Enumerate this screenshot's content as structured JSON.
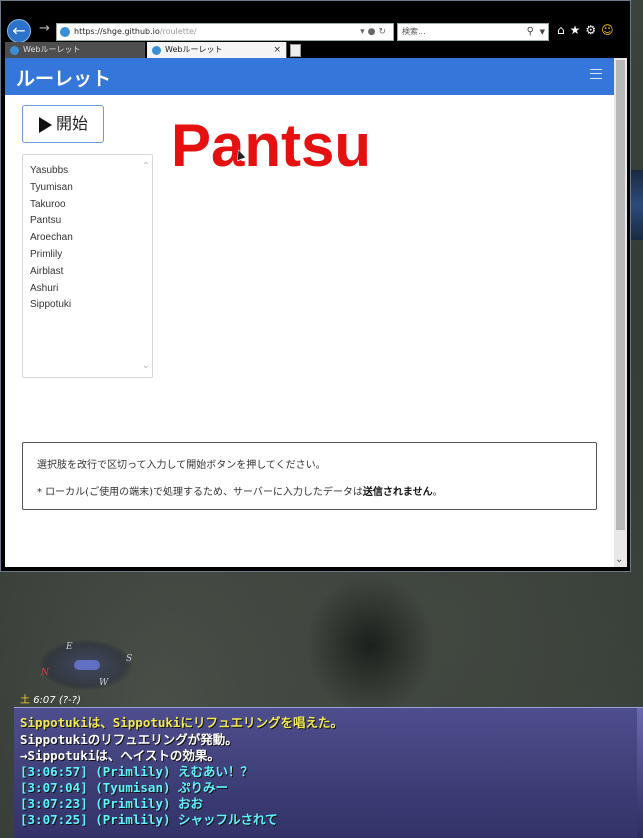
{
  "browser": {
    "url_host": "https://shge.github.io",
    "url_path": "/roulette/",
    "search_placeholder": "検索...",
    "tabs": [
      {
        "label": "Webルーレット",
        "active": false
      },
      {
        "label": "Webルーレット",
        "active": true
      }
    ],
    "tab_close": "×",
    "toolbar_icons": [
      "home-icon",
      "favorites-star-icon",
      "settings-gear-icon",
      "feedback-smiley-icon"
    ]
  },
  "page": {
    "brand": "ルーレット",
    "start_button": "開始",
    "result": "Pantsu",
    "choices": [
      "Yasubbs",
      "Tyumisan",
      "Takuroo",
      "Pantsu",
      "Aroechan",
      "Primlily",
      "Airblast",
      "Ashuri",
      "Sippotuki"
    ],
    "help_line1": "選択肢を改行で区切って入力して開始ボタンを押してください。",
    "help_line2_prefix": "* ローカル(ご使用の端末)で処理するため、サーバーに入力したデータは",
    "help_line2_bold": "送信されません",
    "help_line2_suffix": "。",
    "colors": {
      "navbar": "#3476d9",
      "result": "#e61010",
      "button_border": "#6a9de0"
    }
  },
  "game": {
    "compass": {
      "n": "N",
      "e": "E",
      "s": "S",
      "w": "W"
    },
    "clock_day": "土",
    "clock_time": "6:07 (?-?)",
    "chat": [
      "Sippotukiは、Sippotukiにリフュエリングを唱えた。",
      "Sippotukiのリフュエリングが発動。",
      "→Sippotukiは、ヘイストの効果。",
      "[3:06:57] (Primlily) えむあい！？",
      "[3:07:04] (Tyumisan) ぷりみー",
      "[3:07:23] (Primlily) おお",
      "[3:07:25] (Primlily) シャッフルされて"
    ],
    "colors": {
      "system_yellow": "#f2ea52",
      "party_cyan": "#5ef5ff"
    }
  }
}
